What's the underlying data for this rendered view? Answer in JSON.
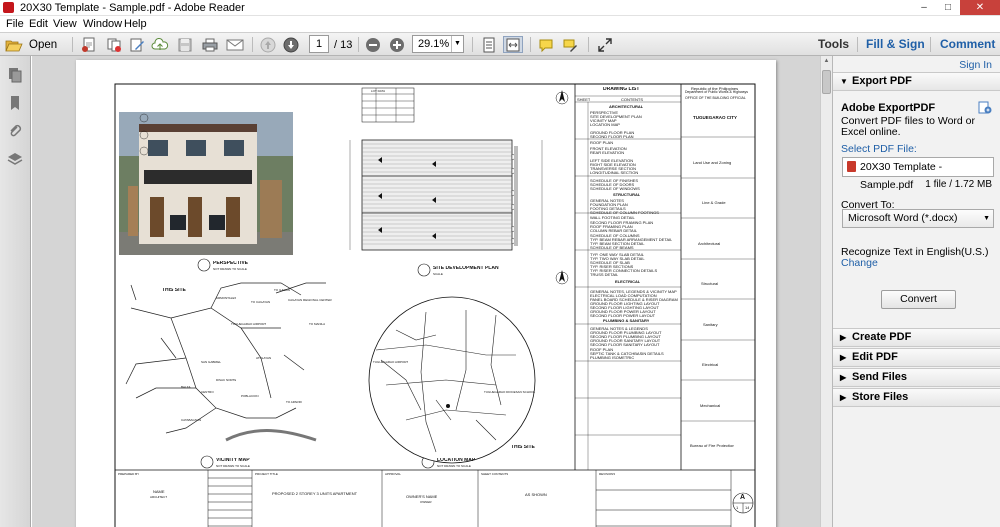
{
  "window": {
    "title": "20X30 Template - Sample.pdf - Adobe Reader",
    "controls": [
      "–",
      "□",
      "✕"
    ]
  },
  "menu": [
    "File",
    "Edit",
    "View",
    "Window",
    "Help"
  ],
  "toolbar": {
    "open_label": "Open",
    "page_current": "1",
    "page_total": "/ 13",
    "zoom": "29.1%",
    "tools": "Tools",
    "fill_sign": "Fill & Sign",
    "comment": "Comment"
  },
  "icons": {
    "open": "folder-open-icon",
    "create": "create-pdf-icon",
    "combine": "combine-icon",
    "edit": "edit-icon",
    "upload": "cloud-upload-icon",
    "save": "save-icon",
    "print": "print-icon",
    "email": "email-icon",
    "prev": "page-up-icon",
    "next": "page-down-icon",
    "zoom_out": "zoom-out-icon",
    "zoom_in": "zoom-in-icon",
    "fit_page": "fit-page-icon",
    "fit_width": "fit-width-icon",
    "sticky": "sticky-note-icon",
    "highlight": "highlight-icon",
    "expand": "expand-icon"
  },
  "accent": "#1f5fa7",
  "right_panel": {
    "sign_in": "Sign In",
    "export_header": "Export PDF",
    "export_title": "Adobe ExportPDF",
    "export_desc": "Convert PDF files to Word or Excel online.",
    "select_label": "Select PDF File:",
    "file_name": "20X30 Template - Sample.pdf",
    "file_info": "1 file / 1.72 MB",
    "convert_to_label": "Convert To:",
    "format": "Microsoft Word (*.docx)",
    "recognize": "Recognize Text in English(U.S.)",
    "change": "Change",
    "convert_button": "Convert",
    "sections": [
      "Create PDF",
      "Edit PDF",
      "Send Files",
      "Store Files"
    ]
  },
  "document": {
    "drawing_list_title": "DRAWING LIST",
    "drawing_list_headers": [
      "SHEET",
      "CONTENTS"
    ],
    "disciplines": [
      "ARCHITECTURAL",
      "STRUCTURAL",
      "ELECTRICAL",
      "PLUMBING & SANITARY"
    ],
    "arch_items": [
      "PERSPECTIVE",
      "SITE DEVELOPMENT PLAN",
      "VICINITY MAP",
      "LOCATION MAP",
      "GROUND FLOOR PLAN",
      "SECOND FLOOR PLAN",
      "ROOF PLAN",
      "FRONT ELEVATION",
      "REAR ELEVATION",
      "LEFT SIDE ELEVATION",
      "RIGHT SIDE ELEVATION",
      "TRANSVERSE SECTION",
      "LONGITUDINAL SECTION",
      "SCHEDULE OF FINISHES",
      "SCHEDULE OF DOORS",
      "SCHEDULE OF WINDOWS"
    ],
    "struct_items": [
      "GENERAL NOTES",
      "FOUNDATION PLAN",
      "FOOTING DETAILS",
      "SCHEDULE OF COLUMN FOOTINGS",
      "WALL FOOTING DETAIL",
      "SECOND FLOOR FRAMING PLAN",
      "ROOF FRAMING PLAN",
      "COLUMN REBAR DETAIL",
      "SCHEDULE OF COLUMNS",
      "TYP. BEAM REBAR ARRANGEMENT DETAIL",
      "TYP. BEAM SECTION DETAIL",
      "SCHEDULE OF BEAMS",
      "TYP. ONE WAY SLAB DETAIL",
      "TYP. TWO WAY SLAB DETAIL",
      "SCHEDULE OF SLAB",
      "TYP. RISER SECTIONS",
      "TYP. RISER CONNECTION DETAILS",
      "TRUSS DETAIL"
    ],
    "elec_items": [
      "GENERAL NOTES, LEGENDS & VICINITY MAP",
      "ELECTRICAL LOAD COMPUTATION",
      "PANEL BOARD SCHEDULE & RISER DIAGRAM",
      "GROUND FLOOR LIGHTING LAYOUT",
      "SECOND FLOOR LIGHTING LAYOUT",
      "GROUND FLOOR POWER LAYOUT",
      "SECOND FLOOR POWER LAYOUT"
    ],
    "plumb_items": [
      "GENERAL NOTES & LEGENDS",
      "GROUND FLOOR PLUMBING LAYOUT",
      "SECOND FLOOR PLUMBING LAYOUT",
      "GROUND FLOOR SANITARY LAYOUT",
      "SECOND FLOOR SANITARY LAYOUT",
      "ROOF PLAN",
      "SEPTIC TANK & CATCHBASIN DETAILS",
      "PLUMBING ISOMETRIC"
    ],
    "republic": "Republic of the Philippines",
    "dpwh": "Department of Public Works & Highways",
    "building_official": "OFFICE OF THE BUILDING OFFICIAL",
    "city": "TUGUEGARAO CITY",
    "stamp_labels": [
      "Land Use and Zoning",
      "Line & Grade",
      "Architectural",
      "Structural",
      "Sanitary",
      "Electrical",
      "Mechanical",
      "Bureau of Fire Protection"
    ],
    "view_perspective": "PERSPECTIVE",
    "view_site": "SITE DEVELOPMENT PLAN",
    "view_vicinity": "VICINITY MAP",
    "view_location": "LOCATION MAP",
    "not_to_scale": "NOT DRAWN TO SCALE",
    "scale_note": "SCALE",
    "this_site": "THIS SITE",
    "lot_data_title": "LOT DATA",
    "map_labels": [
      "TO ILAGAN",
      "ARMONTALES",
      "TO CAGAYAN",
      "CAGAYAN REGIONAL CENTER",
      "TUGUEGARAO AIRPORT",
      "TO MANILA",
      "SAN GABRIEL",
      "DISAC NORTE",
      "CENTRO",
      "BALZA",
      "POBLACION",
      "TO APARRI",
      "CATABAGNAN",
      "ATULAYAN"
    ],
    "loc_labels": [
      "TUGUEGARAO AIRPORT",
      "TUGUEGARAO DIOCESAN SCHOOL"
    ],
    "tb_prepared": "PREPARED BY",
    "tb_name": "NAME",
    "tb_architect": "ARCHITECT",
    "tb_project": "PROJECT TITLE",
    "tb_project_value": "PROPOSED 2 STOREY 3 UNITS APARTMENT",
    "tb_approval": "APPROVAL",
    "tb_owner": "OWNER'S NAME",
    "tb_owner_sub": "OWNER",
    "tb_sheet_contents": "SHEET CONTENTS",
    "tb_as_shown": "AS SHOWN",
    "tb_revisions": "REVISIONS",
    "tb_sheet_letter": "A",
    "tb_sheet_num": "1",
    "tb_sheet_total": "14"
  }
}
